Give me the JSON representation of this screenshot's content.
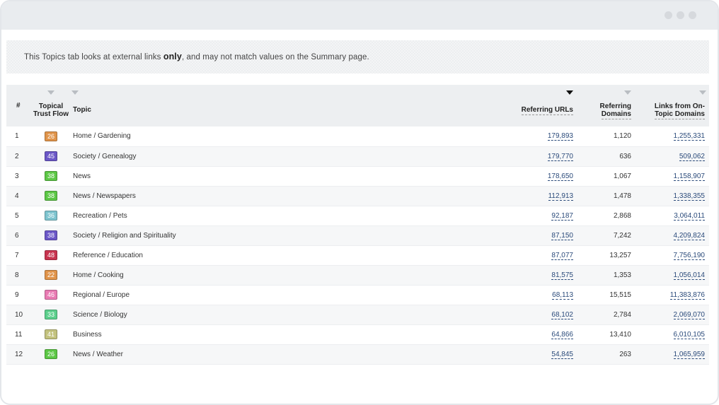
{
  "notice": {
    "text_before": "This Topics tab looks at external links ",
    "text_bold": "only",
    "text_after": ", and may not match values on the Summary page."
  },
  "table": {
    "headers": {
      "num": "#",
      "topical_trust_flow_line1": "Topical",
      "topical_trust_flow_line2": "Trust Flow",
      "topic": "Topic",
      "referring_urls": "Referring URLs",
      "referring_domains_line1": "Referring",
      "referring_domains_line2": "Domains",
      "links_line1": "Links from On-",
      "links_line2": "Topic Domains"
    },
    "rows": [
      {
        "num": "1",
        "tf": "26",
        "color": "#e0944a",
        "topic": "Home / Gardening",
        "ref_urls": "179,893",
        "ref_domains": "1,120",
        "links": "1,255,331"
      },
      {
        "num": "2",
        "tf": "45",
        "color": "#6b57c7",
        "topic": "Society / Genealogy",
        "ref_urls": "179,770",
        "ref_domains": "636",
        "links": "509,062"
      },
      {
        "num": "3",
        "tf": "38",
        "color": "#5cc745",
        "topic": "News",
        "ref_urls": "178,650",
        "ref_domains": "1,067",
        "links": "1,158,907"
      },
      {
        "num": "4",
        "tf": "38",
        "color": "#5cc745",
        "topic": "News / Newspapers",
        "ref_urls": "112,913",
        "ref_domains": "1,478",
        "links": "1,338,355"
      },
      {
        "num": "5",
        "tf": "36",
        "color": "#7ec4cf",
        "topic": "Recreation / Pets",
        "ref_urls": "92,187",
        "ref_domains": "2,868",
        "links": "3,064,011"
      },
      {
        "num": "6",
        "tf": "38",
        "color": "#6b57c7",
        "topic": "Society / Religion and Spirituality",
        "ref_urls": "87,150",
        "ref_domains": "7,242",
        "links": "4,209,824"
      },
      {
        "num": "7",
        "tf": "48",
        "color": "#c8344f",
        "topic": "Reference / Education",
        "ref_urls": "87,077",
        "ref_domains": "13,257",
        "links": "7,756,190"
      },
      {
        "num": "8",
        "tf": "22",
        "color": "#e0944a",
        "topic": "Home / Cooking",
        "ref_urls": "81,575",
        "ref_domains": "1,353",
        "links": "1,056,014"
      },
      {
        "num": "9",
        "tf": "46",
        "color": "#e97bb3",
        "topic": "Regional / Europe",
        "ref_urls": "68,113",
        "ref_domains": "15,515",
        "links": "11,383,876"
      },
      {
        "num": "10",
        "tf": "33",
        "color": "#5ccf8c",
        "topic": "Science / Biology",
        "ref_urls": "68,102",
        "ref_domains": "2,784",
        "links": "2,069,070"
      },
      {
        "num": "11",
        "tf": "41",
        "color": "#c3c27e",
        "topic": "Business",
        "ref_urls": "64,866",
        "ref_domains": "13,410",
        "links": "6,010,105"
      },
      {
        "num": "12",
        "tf": "26",
        "color": "#5cc745",
        "topic": "News / Weather",
        "ref_urls": "54,845",
        "ref_domains": "263",
        "links": "1,065,959"
      }
    ]
  }
}
